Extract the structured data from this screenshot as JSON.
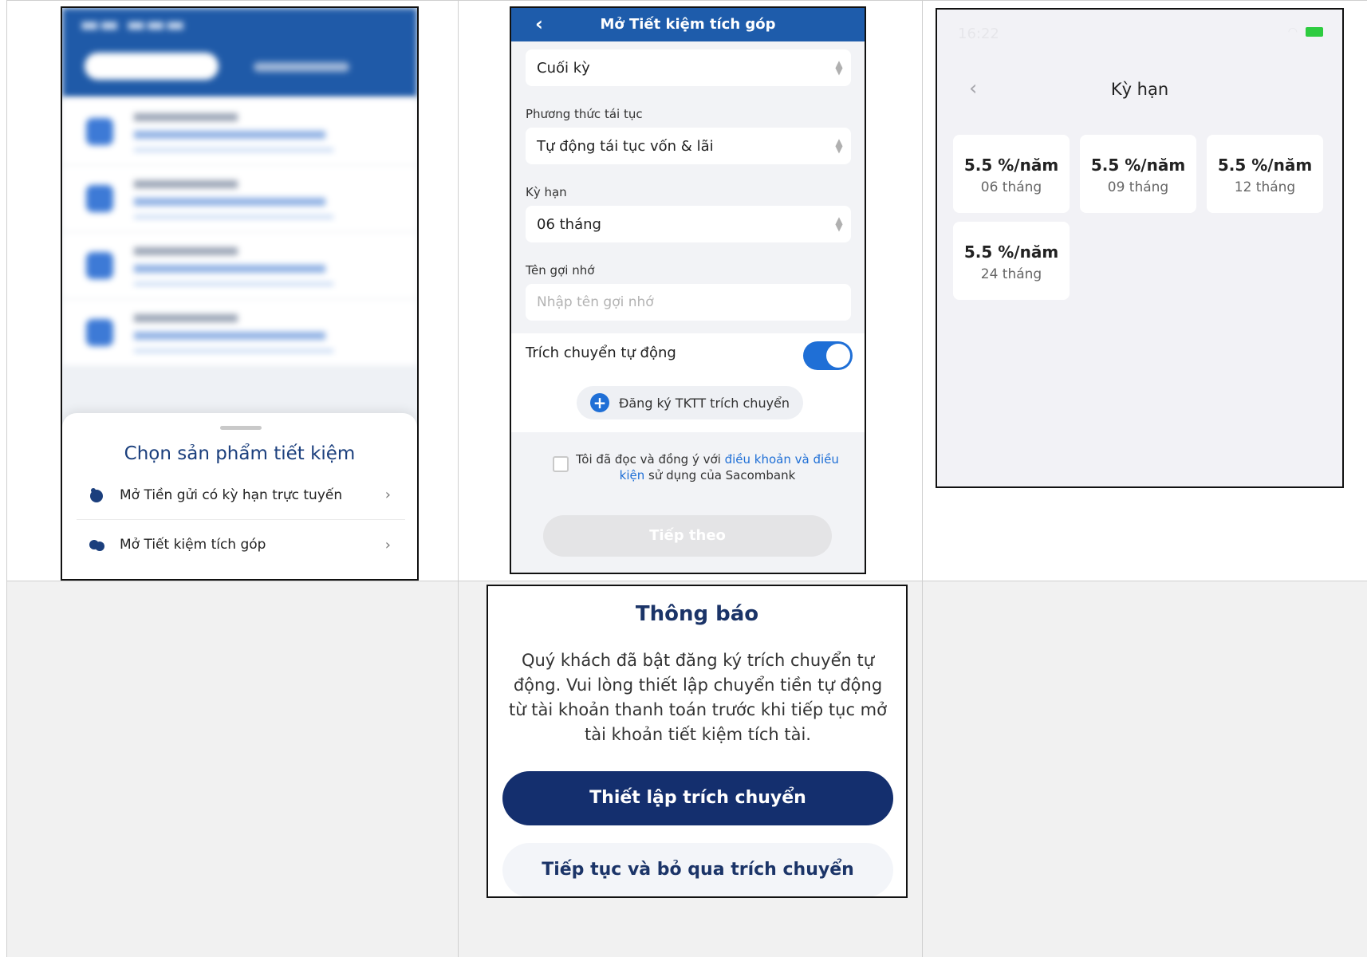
{
  "screen1": {
    "sheet_title": "Chọn sản phẩm tiết kiệm",
    "options": [
      {
        "label": "Mở Tiền gửi có kỳ hạn trực tuyến",
        "icon": "piggy-bank-icon"
      },
      {
        "label": "Mở Tiết kiệm tích góp",
        "icon": "savings-icon"
      }
    ]
  },
  "screen2": {
    "title": "Mở Tiết kiệm tích góp",
    "fields": [
      {
        "value": "Cuối kỳ"
      },
      {
        "label": "Phương thức tái tục",
        "value": "Tự động tái tục vốn & lãi"
      },
      {
        "label": "Kỳ hạn",
        "value": "06 tháng"
      },
      {
        "label": "Tên gợi nhớ",
        "placeholder": "Nhập tên gợi nhớ"
      }
    ],
    "auto_transfer_label": "Trích chuyển tự động",
    "auto_transfer_on": true,
    "register_label": "Đăng ký TKTT trích chuyển",
    "terms": {
      "prefix": "Tôi đã đọc và đồng ý với ",
      "link": "điều khoản và điều kiện",
      "suffix": " sử dụng của Sacombank"
    },
    "next_label": "Tiếp theo"
  },
  "screen3": {
    "title": "Kỳ hạn",
    "terms": [
      {
        "rate": "5.5 %/năm",
        "term": "06 tháng"
      },
      {
        "rate": "5.5 %/năm",
        "term": "09 tháng"
      },
      {
        "rate": "5.5 %/năm",
        "term": "12 tháng"
      },
      {
        "rate": "5.5 %/năm",
        "term": "24 tháng"
      }
    ]
  },
  "dialog": {
    "title": "Thông báo",
    "message": "Quý khách đã bật đăng ký trích chuyển tự động. Vui lòng thiết lập chuyển tiền tự động từ tài khoản thanh toán trước khi tiếp tục mở tài khoản tiết kiệm tích tài.",
    "primary": "Thiết lập trích chuyển",
    "secondary": "Tiếp tục và bỏ qua trích chuyển"
  },
  "colors": {
    "brand_blue": "#1e5cab",
    "navy": "#142f6e",
    "link": "#1f6fd6"
  }
}
